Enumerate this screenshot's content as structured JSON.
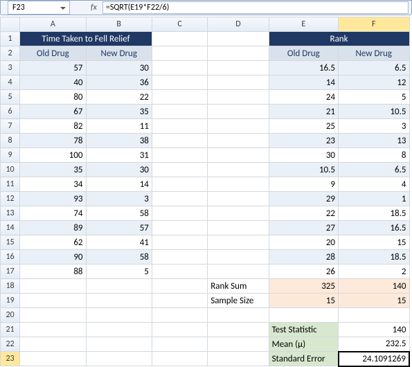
{
  "formula_bar": {
    "cell_ref": "F23",
    "fx_label": "fx",
    "formula": "=SQRT(E19*F22/6)"
  },
  "columns": [
    "A",
    "B",
    "C",
    "D",
    "E",
    "F"
  ],
  "row_numbers": [
    "1",
    "2",
    "3",
    "4",
    "5",
    "6",
    "7",
    "8",
    "9",
    "10",
    "11",
    "12",
    "13",
    "14",
    "15",
    "16",
    "17",
    "18",
    "19",
    "20",
    "21",
    "22",
    "23"
  ],
  "headers": {
    "time_title": "Time Taken to Fell Relief",
    "rank_title": "Rank",
    "old_drug": "Old Drug",
    "new_drug": "New Drug"
  },
  "chart_data": {
    "type": "table",
    "time_old": [
      57,
      40,
      80,
      67,
      82,
      78,
      100,
      35,
      34,
      93,
      74,
      89,
      62,
      90,
      88
    ],
    "time_new": [
      30,
      36,
      22,
      35,
      11,
      38,
      31,
      30,
      14,
      3,
      58,
      57,
      41,
      58,
      5
    ],
    "rank_old": [
      16.5,
      14,
      24,
      21,
      25,
      23,
      30,
      10.5,
      9,
      29,
      22,
      27,
      20,
      28,
      26
    ],
    "rank_new": [
      6.5,
      12,
      5,
      10.5,
      3,
      13,
      8,
      6.5,
      4,
      1,
      18.5,
      16.5,
      15,
      18.5,
      2
    ]
  },
  "summary": {
    "rank_sum_label": "Rank Sum",
    "rank_sum_old": 325,
    "rank_sum_new": 140,
    "sample_size_label": "Sample Size",
    "sample_size_old": 15,
    "sample_size_new": 15
  },
  "stats": {
    "test_stat_label": "Test Statistic",
    "test_stat_val": 140,
    "mean_label": "Mean (μ)",
    "mean_val": 232.5,
    "stderr_label": "Standard Error",
    "stderr_val": "24.1091269"
  }
}
